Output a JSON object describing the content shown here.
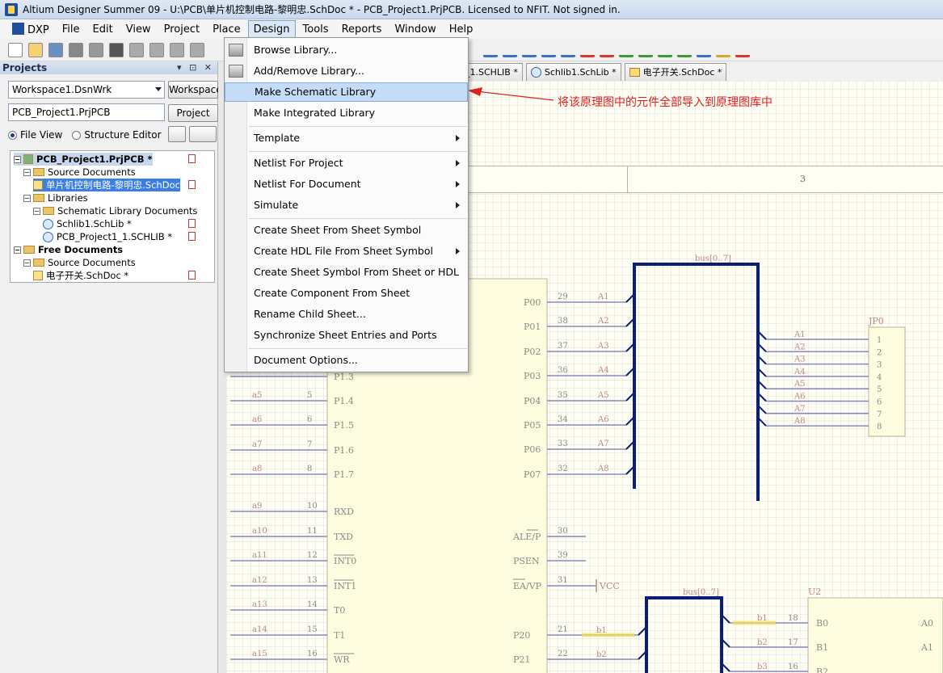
{
  "window": {
    "title": "Altium Designer Summer 09 - U:\\PCB\\单片机控制电路-黎明忠.SchDoc * - PCB_Project1.PrjPCB. Licensed to NFIT. Not signed in."
  },
  "menubar": {
    "items": [
      "DXP",
      "File",
      "Edit",
      "View",
      "Project",
      "Place",
      "Design",
      "Tools",
      "Reports",
      "Window",
      "Help"
    ],
    "active": "Design"
  },
  "projects_panel": {
    "title": "Projects",
    "controls": "▾ ⊡ ✕",
    "workspace_value": "Workspace1.DsnWrk",
    "workspace_button": "Workspace",
    "project_value": "PCB_Project1.PrjPCB",
    "project_button": "Project",
    "radio_file_view": "File View",
    "radio_structure_editor": "Structure Editor",
    "tree": [
      {
        "label": "PCB_Project1.PrjPCB *",
        "level": 0,
        "bold": true,
        "hl": true
      },
      {
        "label": "Source Documents",
        "level": 1
      },
      {
        "label": "单片机控制电路-黎明忠.SchDoc",
        "level": 2,
        "selected": true
      },
      {
        "label": "Libraries",
        "level": 1
      },
      {
        "label": "Schematic Library Documents",
        "level": 2
      },
      {
        "label": "Schlib1.SchLib *",
        "level": 3
      },
      {
        "label": "PCB_Project1_1.SCHLIB *",
        "level": 3
      },
      {
        "label": "Free Documents",
        "level": 0,
        "bold": true
      },
      {
        "label": "Source Documents",
        "level": 1
      },
      {
        "label": "电子开关.SchDoc *",
        "level": 2
      }
    ]
  },
  "tabs": [
    "_1.SCHLIB *",
    "Schlib1.SchLib *",
    "电子开关.SchDoc *"
  ],
  "design_menu": {
    "items": [
      {
        "label": "Browse Library...",
        "sep_after": false
      },
      {
        "label": "Add/Remove Library...",
        "sep_after": false
      },
      {
        "label": "Make Schematic Library",
        "hover": true,
        "sep_after": false
      },
      {
        "label": "Make Integrated Library",
        "sep_after": true
      },
      {
        "label": "Template",
        "submenu": true,
        "sep_after": true
      },
      {
        "label": "Netlist For Project",
        "submenu": true,
        "sep_after": false
      },
      {
        "label": "Netlist For Document",
        "submenu": true,
        "sep_after": false
      },
      {
        "label": "Simulate",
        "submenu": true,
        "sep_after": true
      },
      {
        "label": "Create Sheet From Sheet Symbol",
        "sep_after": false
      },
      {
        "label": "Create HDL File From Sheet Symbol",
        "submenu": true,
        "sep_after": false
      },
      {
        "label": "Create Sheet Symbol From Sheet or HDL",
        "sep_after": false
      },
      {
        "label": "Create Component From Sheet",
        "sep_after": false
      },
      {
        "label": "Rename Child Sheet...",
        "sep_after": false
      },
      {
        "label": "Synchronize Sheet Entries and Ports",
        "sep_after": true
      },
      {
        "label": "Document Options...",
        "sep_after": false
      }
    ]
  },
  "annotation": "将该原理图中的元件全部导入到原理图库中",
  "schematic": {
    "zone_label": "3",
    "bus_top": "bus[0..7]",
    "bus_bottom": "bus[0..7]",
    "connector": "JP0",
    "chip_u2": "U2",
    "vcc": "VCC",
    "left_pins": [
      {
        "net": "",
        "num": "",
        "name": "P1.3"
      },
      {
        "net": "a5",
        "num": "5",
        "name": "P1.4"
      },
      {
        "net": "a6",
        "num": "6",
        "name": "P1.5"
      },
      {
        "net": "a7",
        "num": "7",
        "name": "P1.6"
      },
      {
        "net": "a8",
        "num": "8",
        "name": "P1.7"
      },
      {
        "net": "a9",
        "num": "10",
        "name": "RXD"
      },
      {
        "net": "a10",
        "num": "11",
        "name": "TXD"
      },
      {
        "net": "a11",
        "num": "12",
        "name": "INT0"
      },
      {
        "net": "a12",
        "num": "13",
        "name": "INT1"
      },
      {
        "net": "a13",
        "num": "14",
        "name": "T0"
      },
      {
        "net": "a14",
        "num": "15",
        "name": "T1"
      },
      {
        "net": "a15",
        "num": "16",
        "name": "WR"
      }
    ],
    "right_pins": [
      {
        "name": "P00",
        "num": "29",
        "net": "A1"
      },
      {
        "name": "P01",
        "num": "38",
        "net": "A2"
      },
      {
        "name": "P02",
        "num": "37",
        "net": "A3"
      },
      {
        "name": "P03",
        "num": "36",
        "net": "A4"
      },
      {
        "name": "P04",
        "num": "35",
        "net": "A5"
      },
      {
        "name": "P05",
        "num": "34",
        "net": "A6"
      },
      {
        "name": "P06",
        "num": "33",
        "net": "A7"
      },
      {
        "name": "P07",
        "num": "32",
        "net": "A8"
      }
    ],
    "ctrl_pins": [
      {
        "name": "ALE/P",
        "num": "30"
      },
      {
        "name": "PSEN",
        "num": "39"
      },
      {
        "name": "EA/VP",
        "num": "31"
      },
      {
        "name": "P20",
        "num": "21",
        "net": "b1"
      },
      {
        "name": "P21",
        "num": "22",
        "net": "b2"
      }
    ],
    "jp_nets": [
      "A1",
      "A2",
      "A3",
      "A4",
      "A5",
      "A6",
      "A7",
      "A8"
    ],
    "jp_pins": [
      "1",
      "2",
      "3",
      "4",
      "5",
      "6",
      "7",
      "8"
    ],
    "u2_rows": [
      {
        "net": "b1",
        "num": "18",
        "name": "B0",
        "right": "A0"
      },
      {
        "net": "b2",
        "num": "17",
        "name": "B1",
        "right": "A1"
      },
      {
        "net": "b3",
        "num": "16",
        "name": "B2",
        "right": ""
      }
    ]
  }
}
